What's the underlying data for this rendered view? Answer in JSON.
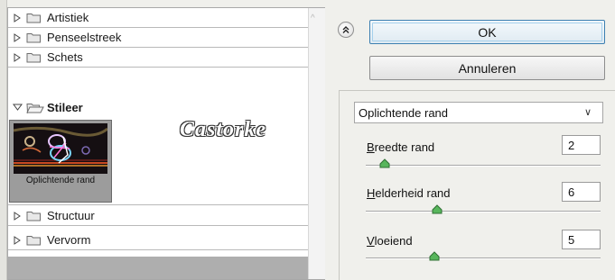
{
  "categories": [
    {
      "label": "Artistiek",
      "expanded": false
    },
    {
      "label": "Penseelstreek",
      "expanded": false
    },
    {
      "label": "Schets",
      "expanded": false
    },
    {
      "label": "Stileer",
      "expanded": true
    },
    {
      "label": "Structuur",
      "expanded": false
    },
    {
      "label": "Vervorm",
      "expanded": false
    }
  ],
  "thumbnail": {
    "label": "Oplichtende rand"
  },
  "watermark": "Castorke",
  "buttons": {
    "ok": "OK",
    "cancel": "Annuleren"
  },
  "filter": {
    "selected": "Oplichtende rand"
  },
  "params": [
    {
      "label_first": "B",
      "label_rest": "reedte rand",
      "value": "2",
      "slider_fraction": 0.07
    },
    {
      "label_first": "H",
      "label_rest": "elderheid rand",
      "value": "6",
      "slider_fraction": 0.3
    },
    {
      "label_first": "V",
      "label_rest": "loeiend",
      "value": "5",
      "slider_fraction": 0.3
    }
  ],
  "colors": {
    "accent_border": "#3c7fb1",
    "slider_thumb": "#58b65c",
    "grey_bg": "#aeaeae"
  }
}
